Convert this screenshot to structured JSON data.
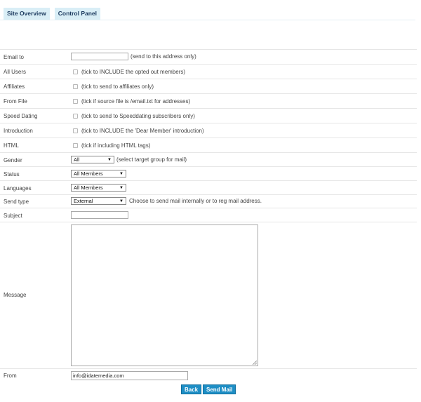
{
  "nav": {
    "tabs": [
      "Site Overview",
      "Control Panel"
    ]
  },
  "form": {
    "email_to": {
      "label": "Email to",
      "value": "",
      "hint": "(send to this address only)"
    },
    "all_users": {
      "label": "All Users",
      "hint": "(tick to INCLUDE the opted out members)"
    },
    "affiliates": {
      "label": "Affiliates",
      "hint": "(tick to send to affiliates only)"
    },
    "from_file": {
      "label": "From File",
      "hint": "(tick if source file is /email.txt for addresses)"
    },
    "speed_dating": {
      "label": "Speed Dating",
      "hint": "(tick to send to Speeddating subscribers only)"
    },
    "introduction": {
      "label": "Introduction",
      "hint": "(tick to INCLUDE the 'Dear Member' introduction)"
    },
    "html": {
      "label": "HTML",
      "hint": "(tick if including HTML tags)"
    },
    "gender": {
      "label": "Gender",
      "value": "All",
      "hint": "(select target group for mail)"
    },
    "status": {
      "label": "Status",
      "value": "All Members"
    },
    "languages": {
      "label": "Languages",
      "value": "All Members"
    },
    "send_type": {
      "label": "Send type",
      "value": "External",
      "hint": "Choose to send mail internally or to reg mail address."
    },
    "subject": {
      "label": "Subject",
      "value": ""
    },
    "message": {
      "label": "Message",
      "value": ""
    },
    "from": {
      "label": "From",
      "value": "info@idatemedia.com"
    }
  },
  "buttons": {
    "back": "Back",
    "send": "Send Mail"
  }
}
